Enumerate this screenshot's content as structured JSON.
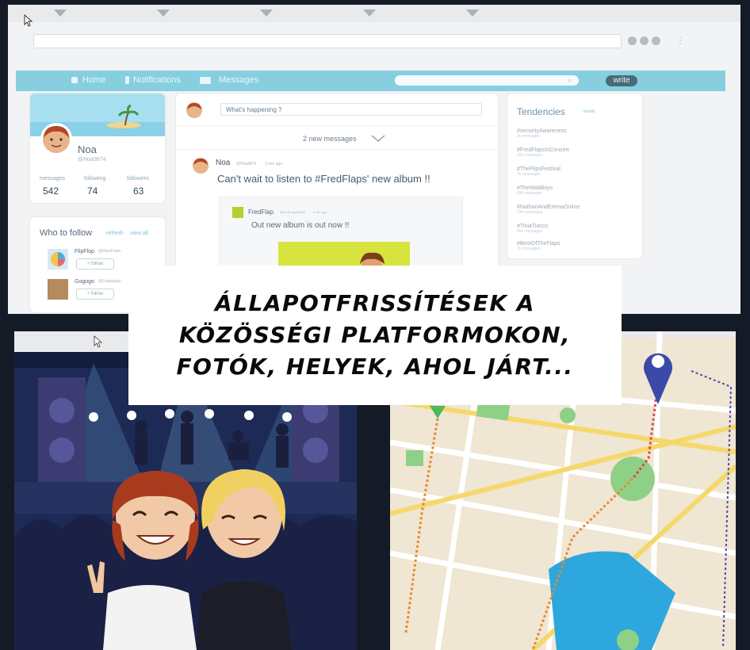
{
  "caption": {
    "line1": "Állapotfrissítések a",
    "line2": "közösségi platformokon,",
    "line3": "fotók, helyek, ahol járt..."
  },
  "browser": {
    "nav": {
      "home": "Home",
      "notifications": "Notifications",
      "messages": "Messages",
      "write": "write"
    },
    "profile": {
      "name": "Noa",
      "handle": "@Noa9874",
      "stats": [
        {
          "label": "messages",
          "value": "542"
        },
        {
          "label": "following",
          "value": "74"
        },
        {
          "label": "followers",
          "value": "63"
        }
      ]
    },
    "who_to_follow": {
      "title": "Who to follow",
      "refresh": "refresh",
      "view_all": "view all",
      "users": [
        {
          "name": "FlipFlop",
          "handle": "@FlipoFlopo",
          "button": "+ follow"
        },
        {
          "name": "Gogogo",
          "handle": "@Gogogogo",
          "button": "+ follow"
        }
      ]
    },
    "feed": {
      "compose_placeholder": "What's happening ?",
      "new_messages": "2 new messages",
      "post": {
        "author": "Noa",
        "handle": "@Noa9874",
        "time": "3 min ago",
        "text": "Can't wait to listen to #FredFlaps' new album !!",
        "quoted": {
          "author": "FredFlap",
          "handle": "@FredFlapOfficial",
          "time": "5 min ago",
          "text": "Out new album is out now !!"
        }
      }
    },
    "tendencies": {
      "title": "Tendencies",
      "link": "modify",
      "items": [
        {
          "tag": "#securityAwareness",
          "count": "3k messages"
        },
        {
          "tag": "#FredFlapsInConcert",
          "count": "16k messages"
        },
        {
          "tag": "#TheFlipsFestival",
          "count": "1k messages"
        },
        {
          "tag": "#TheWaltBoys",
          "count": "43k messages"
        },
        {
          "tag": "#NathanAndEmmaOnline",
          "count": "23k messages"
        },
        {
          "tag": "#TiniaTiacco",
          "count": "20k messages"
        },
        {
          "tag": "#BestOfTheFlaps",
          "count": "7k messages"
        }
      ]
    }
  },
  "colors": {
    "navbar": "#87cfe0",
    "caption_bg": "#ffffff",
    "frame": "#151b26",
    "map_green": "#8fd087",
    "map_water": "#2ea7de",
    "pin": "#3b4aa8"
  },
  "icons": {
    "cursor": "cursor-icon",
    "chevron": "chevron-down-icon",
    "pin": "map-pin-icon",
    "home": "home-icon",
    "notifications": "bell-icon",
    "messages": "envelope-icon"
  }
}
